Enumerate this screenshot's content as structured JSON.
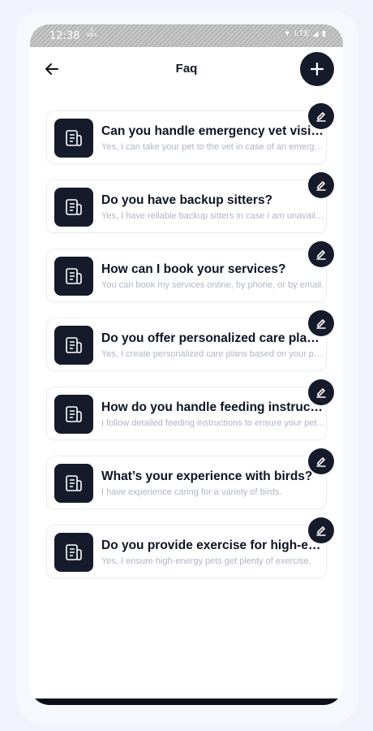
{
  "status": {
    "time": "12:38",
    "speed_value": "0",
    "speed_unit": "KB/s",
    "network": "LTE"
  },
  "header": {
    "title": "Faq",
    "back_icon": "arrow-left-icon",
    "add_icon": "plus-icon"
  },
  "colors": {
    "accent": "#161b2b",
    "muted_text": "#b0b6c3",
    "title_text": "#0f1424"
  },
  "faqs": [
    {
      "question": "Can you handle emergency vet visits?",
      "answer": "Yes, I can take your pet to the vet in case of an emergency."
    },
    {
      "question": "Do you have backup sitters?",
      "answer": "Yes, I have reliable backup sitters in case I am unavailable."
    },
    {
      "question": "How can I book your services?",
      "answer": "You can book my services online, by phone, or by email."
    },
    {
      "question": "Do you offer personalized care plans?",
      "answer": "Yes, I create personalized care plans based on your pet's needs."
    },
    {
      "question": "How do you handle feeding instructions?",
      "answer": "I follow detailed feeding instructions to ensure your pet's diet."
    },
    {
      "question": "What’s your experience with birds?",
      "answer": "I have experience caring for a variety of birds."
    },
    {
      "question": "Do you provide exercise for high-energy pets?",
      "answer": "Yes, I ensure high-energy pets get plenty of exercise."
    }
  ]
}
